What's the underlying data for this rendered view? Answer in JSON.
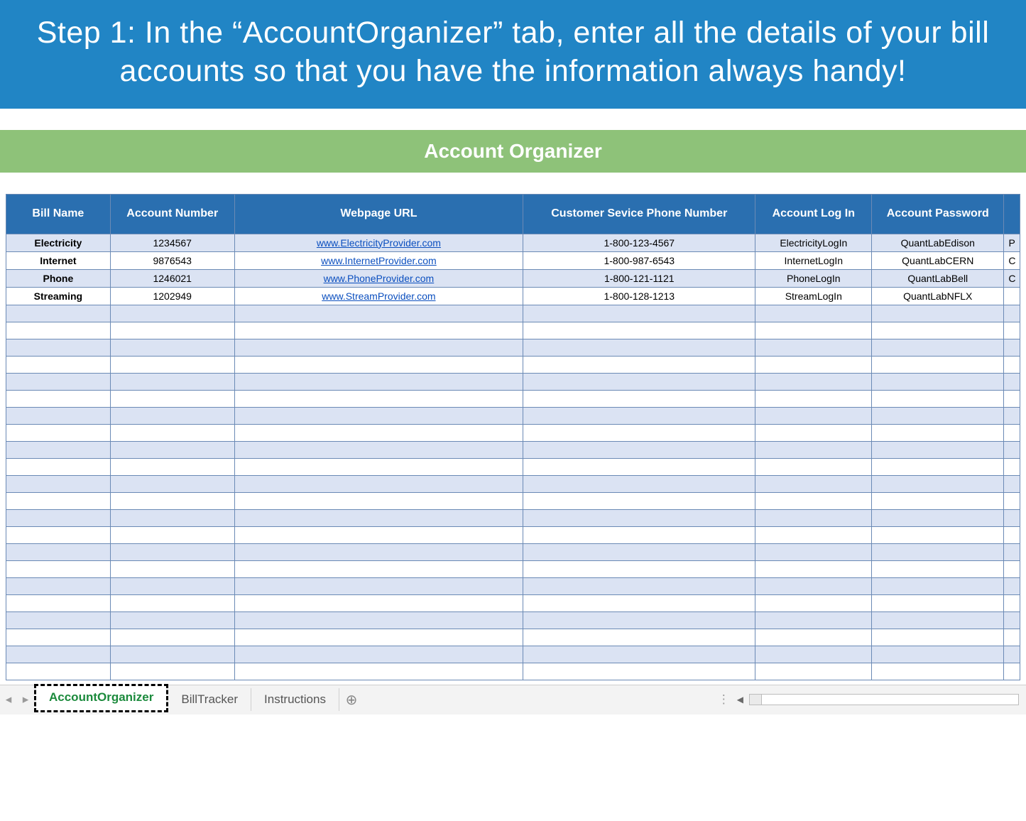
{
  "banner": "Step 1: In the “AccountOrganizer” tab, enter all the details of your bill accounts so that you have the information always handy!",
  "section_title": "Account Organizer",
  "columns": [
    "Bill Name",
    "Account Number",
    "Webpage URL",
    "Customer Sevice Phone Number",
    "Account Log In",
    "Account Password"
  ],
  "rows": [
    {
      "bill": "Electricity",
      "acct": "1234567",
      "url": "www.ElectricityProvider.com",
      "phone": "1-800-123-4567",
      "login": "ElectricityLogIn",
      "pwd": "QuantLabEdison",
      "extra": "P"
    },
    {
      "bill": "Internet",
      "acct": "9876543",
      "url": "www.InternetProvider.com",
      "phone": "1-800-987-6543",
      "login": "InternetLogIn",
      "pwd": "QuantLabCERN",
      "extra": "C"
    },
    {
      "bill": "Phone",
      "acct": "1246021",
      "url": "www.PhoneProvider.com",
      "phone": "1-800-121-1121",
      "login": "PhoneLogIn",
      "pwd": "QuantLabBell",
      "extra": "C"
    },
    {
      "bill": "Streaming",
      "acct": "1202949",
      "url": "www.StreamProvider.com",
      "phone": "1-800-128-1213",
      "login": "StreamLogIn",
      "pwd": "QuantLabNFLX",
      "extra": ""
    }
  ],
  "empty_row_count": 22,
  "tabs": {
    "items": [
      "AccountOrganizer",
      "BillTracker",
      "Instructions"
    ],
    "active_index": 0,
    "add_label": "⊕"
  }
}
